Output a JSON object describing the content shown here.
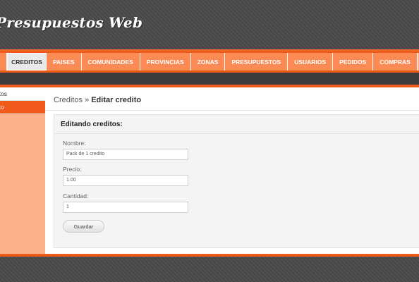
{
  "header": {
    "title": "Presupuestos Web"
  },
  "nav": {
    "items": [
      "CREDITOS",
      "PAISES",
      "COMUNIDADES",
      "PROVINCIAS",
      "ZONAS",
      "PRESUPUESTOS",
      "USUARIOS",
      "PEDIDOS",
      "COMPRAS"
    ],
    "active": "CREDITOS"
  },
  "sidebar": {
    "items": [
      {
        "label": "ditos"
      },
      {
        "label": "dito"
      }
    ]
  },
  "breadcrumb": {
    "parent": "Creditos",
    "separator": "»",
    "current": "Editar credito"
  },
  "form": {
    "title": "Editando creditos:",
    "nombre_label": "Nombre:",
    "nombre_value": "Pack de 1 credito",
    "precio_label": "Precio:",
    "precio_value": "1.00",
    "cantidad_label": "Cantidad:",
    "cantidad_value": "1",
    "submit_label": "Guardar"
  },
  "colors": {
    "accent": "#f05a1a",
    "nav_bg": "#fb8a55",
    "sidebar_bg": "#fdb08a",
    "page_bg": "#4a4a4a"
  }
}
